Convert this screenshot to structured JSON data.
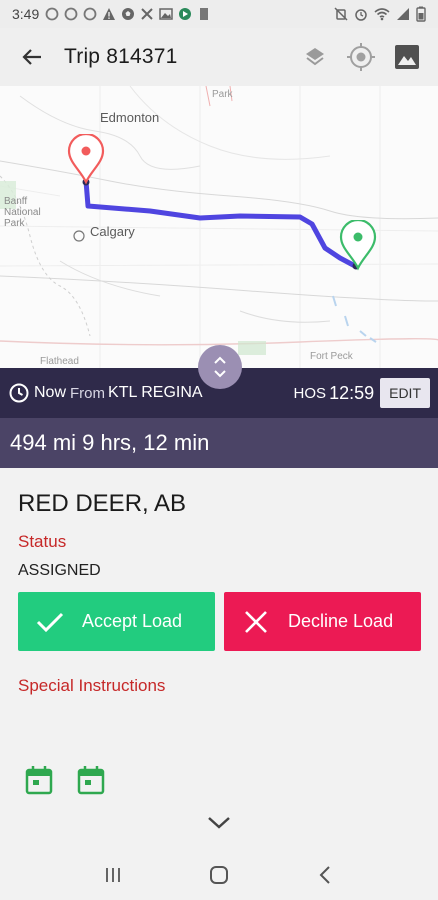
{
  "status_bar": {
    "time": "3:49"
  },
  "app_bar": {
    "title": "Trip 814371"
  },
  "map": {
    "labels": {
      "edmonton": "Edmonton",
      "calgary": "Calgary",
      "banff": "Banff",
      "national": "National",
      "park_banff": "Park",
      "flathead": "Flathead",
      "fort_peck": "Fort Peck",
      "park_top": "Park"
    }
  },
  "info_bar": {
    "now": "Now",
    "from": "From",
    "origin": "KTL REGINA",
    "hos_label": "HOS",
    "hos_value": "12:59",
    "edit_label": "EDIT"
  },
  "distance_bar": {
    "text": "494 mi 9 hrs, 12 min"
  },
  "details": {
    "destination": "RED DEER, AB",
    "status_label": "Status",
    "status_value": "ASSIGNED",
    "special_instructions_label": "Special Instructions"
  },
  "actions": {
    "accept_label": "Accept Load",
    "decline_label": "Decline Load"
  },
  "colors": {
    "accent": "#2f2a4a",
    "accept": "#22cc7f",
    "decline": "#ec1a54",
    "label_red": "#c62828",
    "route": "#5b4fe0",
    "calendar_green": "#2fa84f"
  }
}
